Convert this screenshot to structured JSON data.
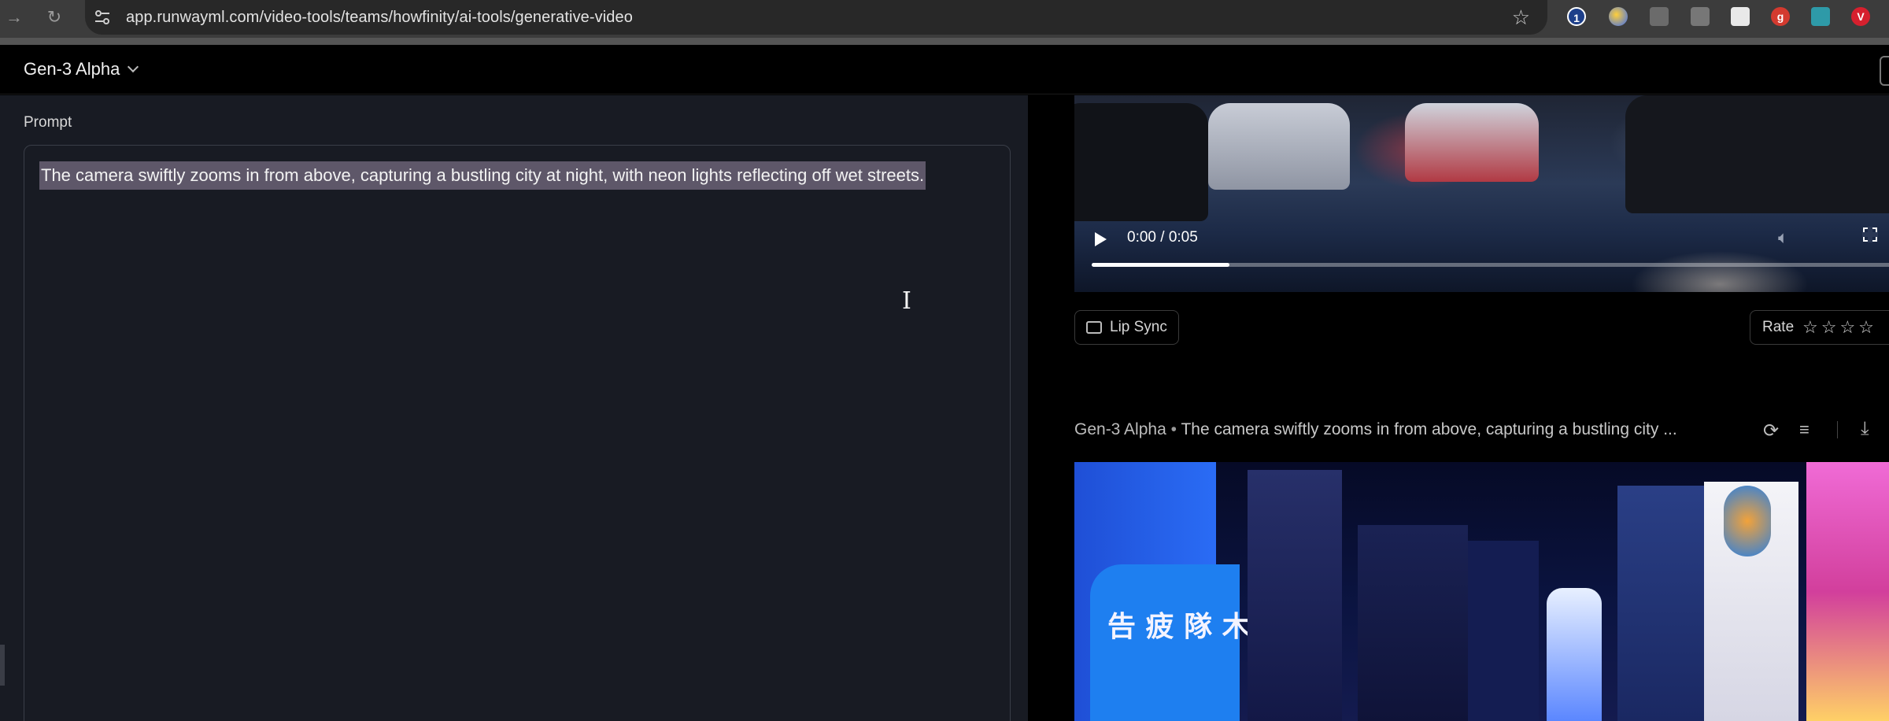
{
  "browser": {
    "url": "app.runwayml.com/video-tools/teams/howfinity/ai-tools/generative-video",
    "extensions": [
      "1",
      "",
      "",
      "",
      "",
      "g",
      "",
      "V"
    ]
  },
  "header": {
    "model_name": "Gen-3 Alpha"
  },
  "left": {
    "prompt_label": "Prompt",
    "prompt_text": "The camera swiftly zooms in from above, capturing a bustling city at night, with neon lights reflecting off wet streets."
  },
  "right": {
    "video1": {
      "time": "0:00 / 0:05",
      "progress": 0.17
    },
    "lip_sync_label": "Lip Sync",
    "rate_label": "Rate",
    "rate_stars": "☆☆☆☆",
    "generation": {
      "model": "Gen-3 Alpha",
      "separator": "•",
      "prompt_truncated": "The camera swiftly zooms in from above, capturing a bustling city ..."
    },
    "video2": {
      "sign_text": "告 疲 隊 木"
    }
  },
  "colors": {
    "left_panel_bg": "#181b23",
    "selection": "#5e5769",
    "page_bg": "#000000"
  }
}
